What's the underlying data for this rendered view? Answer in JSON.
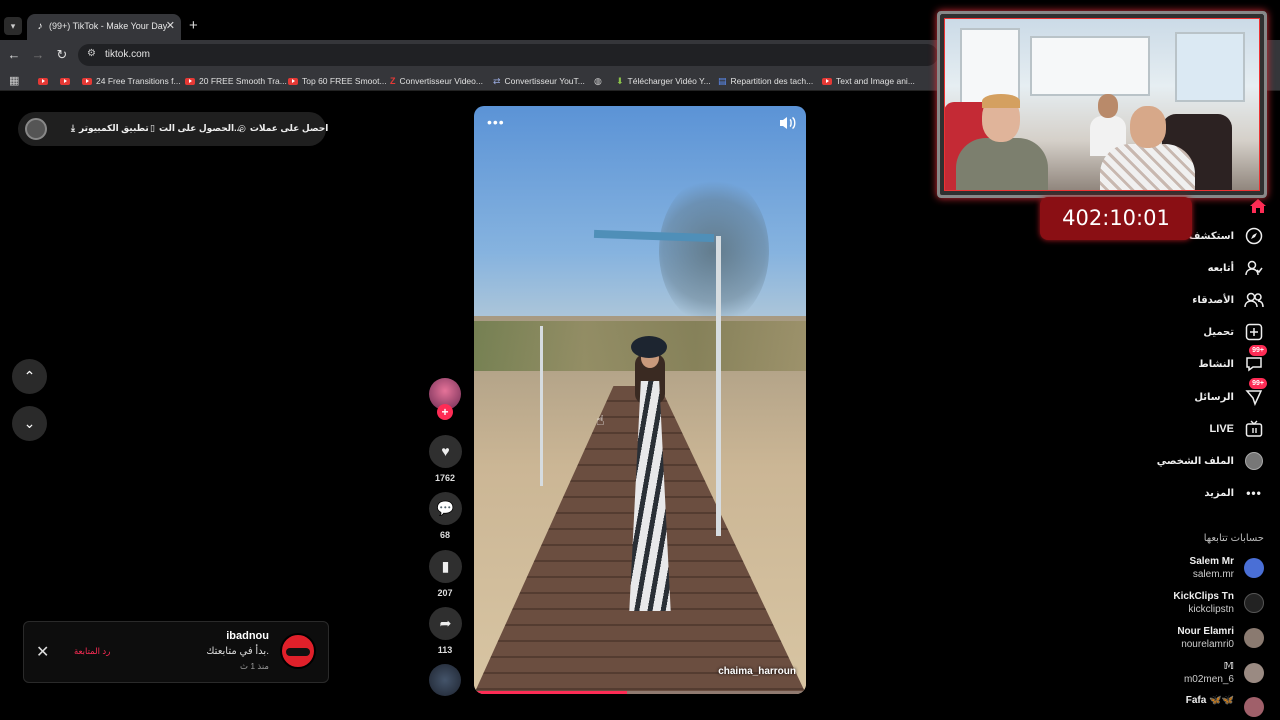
{
  "browser": {
    "tab_title": "(99+) TikTok - Make Your Day",
    "tab_favicon": "tiktok-icon",
    "url": "tiktok.com",
    "bookmarks": [
      {
        "label": "",
        "icon": "youtube-icon"
      },
      {
        "label": "",
        "icon": "youtube-icon"
      },
      {
        "label": "24 Free Transitions f...",
        "icon": "youtube-icon"
      },
      {
        "label": "20 FREE Smooth Tra...",
        "icon": "youtube-icon"
      },
      {
        "label": "Top 60 FREE Smoot...",
        "icon": "youtube-icon"
      },
      {
        "label": "Convertisseur Video...",
        "icon": "z-icon"
      },
      {
        "label": "Convertisseur YouT...",
        "icon": "convert-icon"
      },
      {
        "label": "",
        "icon": "globe-icon"
      },
      {
        "label": "Télécharger Vidéo Y...",
        "icon": "download-icon"
      },
      {
        "label": "Repartition des tach...",
        "icon": "docs-icon"
      },
      {
        "label": "Text and Image ani...",
        "icon": "youtube-icon"
      }
    ]
  },
  "topbar": {
    "get_coins": "احصل على عملات",
    "get_app": "الحصول على الت...",
    "desktop_app": "تطبيق الكمبيوتر"
  },
  "video": {
    "author": "chaima_harroun",
    "progress_fraction": 0.46
  },
  "actions": {
    "likes": "1762",
    "comments": "68",
    "saves": "207",
    "shares": "113"
  },
  "notification": {
    "name": "ibadnou",
    "text": "بدأ في متابعتك.",
    "time": "منذ 1 ث",
    "follow_back": "رد المتابعة"
  },
  "sidebar": {
    "items": [
      {
        "label": "استكشف",
        "icon": "compass-icon"
      },
      {
        "label": "أتابعه",
        "icon": "following-icon"
      },
      {
        "label": "الأصدقاء",
        "icon": "friends-icon"
      },
      {
        "label": "تحميل",
        "icon": "upload-icon"
      },
      {
        "label": "النشاط",
        "icon": "activity-icon",
        "badge": "99+"
      },
      {
        "label": "الرسائل",
        "icon": "messages-icon",
        "badge": "99+"
      },
      {
        "label": "LIVE",
        "icon": "live-icon"
      },
      {
        "label": "الملف الشخصي",
        "icon": "profile-icon"
      },
      {
        "label": "المزيد",
        "icon": "more-icon"
      }
    ],
    "following_title": "حسابات تتابعها",
    "following": [
      {
        "name": "Salem Mr",
        "handle": "salem.mr"
      },
      {
        "name": "KickClips Tn",
        "handle": "kickclipstn"
      },
      {
        "name": "Nour Elamri",
        "handle": "nourelamri0"
      },
      {
        "name": "𝕄",
        "handle": "m02men_6"
      },
      {
        "name": "Fafa 🦋🦋",
        "handle": ""
      }
    ]
  },
  "overlay": {
    "timer": "402:10:01"
  },
  "colors": {
    "accent": "#fe2c55",
    "timer_bg": "#8a0f14"
  }
}
